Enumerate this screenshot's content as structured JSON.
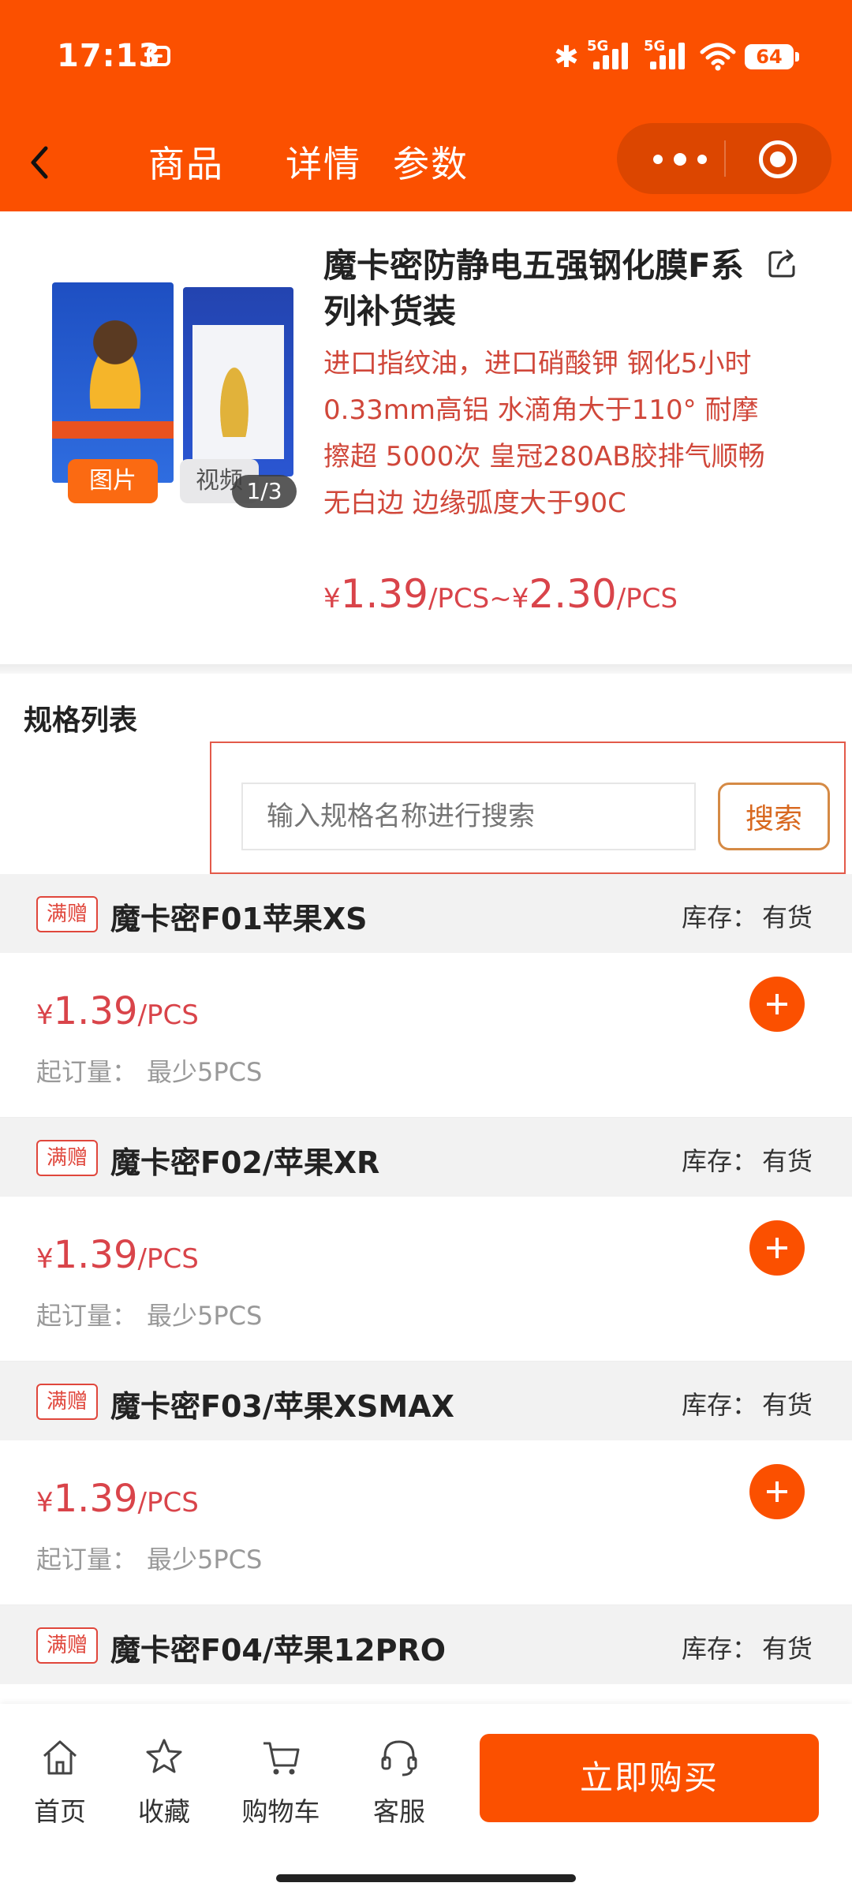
{
  "status_bar": {
    "time": "17:13",
    "network_1": "5G",
    "network_2": "5G",
    "battery": "64"
  },
  "nav": {
    "tabs": [
      "商品",
      "详情",
      "参数"
    ]
  },
  "product": {
    "title": "魔卡密防静电五强钢化膜F系列补货装",
    "description": "进口指纹油，进口硝酸钾 钢化5小时 0.33mm高铝 水滴角大于110° 耐摩擦超 5000次 皇冠280AB胶排气顺畅 无白边 边缘弧度大于90C",
    "price_low_symbol": "¥",
    "price_low": "1.39",
    "price_unit": "/PCS",
    "price_sep": "~",
    "price_high_symbol": "¥",
    "price_high": "2.30",
    "gallery": {
      "image_chip": "图片",
      "video_chip": "视频",
      "counter": "1/3"
    }
  },
  "spec_section": {
    "title": "规格列表",
    "search_placeholder": "输入规格名称进行搜索",
    "search_button": "搜索"
  },
  "spec_items": [
    {
      "badge": "满赠",
      "name": "魔卡密F01苹果XS",
      "stock_label": "库存：",
      "stock": "有货",
      "currency": "¥",
      "price": "1.39",
      "unit": "/PCS",
      "moq_label": "起订量：",
      "moq": "最少5PCS"
    },
    {
      "badge": "满赠",
      "name": "魔卡密F02/苹果XR",
      "stock_label": "库存：",
      "stock": "有货",
      "currency": "¥",
      "price": "1.39",
      "unit": "/PCS",
      "moq_label": "起订量：",
      "moq": "最少5PCS"
    },
    {
      "badge": "满赠",
      "name": "魔卡密F03/苹果XSMAX",
      "stock_label": "库存：",
      "stock": "有货",
      "currency": "¥",
      "price": "1.39",
      "unit": "/PCS",
      "moq_label": "起订量：",
      "moq": "最少5PCS"
    },
    {
      "badge": "满赠",
      "name": "魔卡密F04/苹果12PRO",
      "stock_label": "库存：",
      "stock": "有货"
    }
  ],
  "bottom_bar": {
    "home": "首页",
    "favorite": "收藏",
    "cart": "购物车",
    "service": "客服",
    "buy_now": "立即购买"
  },
  "colors": {
    "brand": "#fb5000",
    "price": "#d9444a",
    "badge": "#e0473c"
  }
}
